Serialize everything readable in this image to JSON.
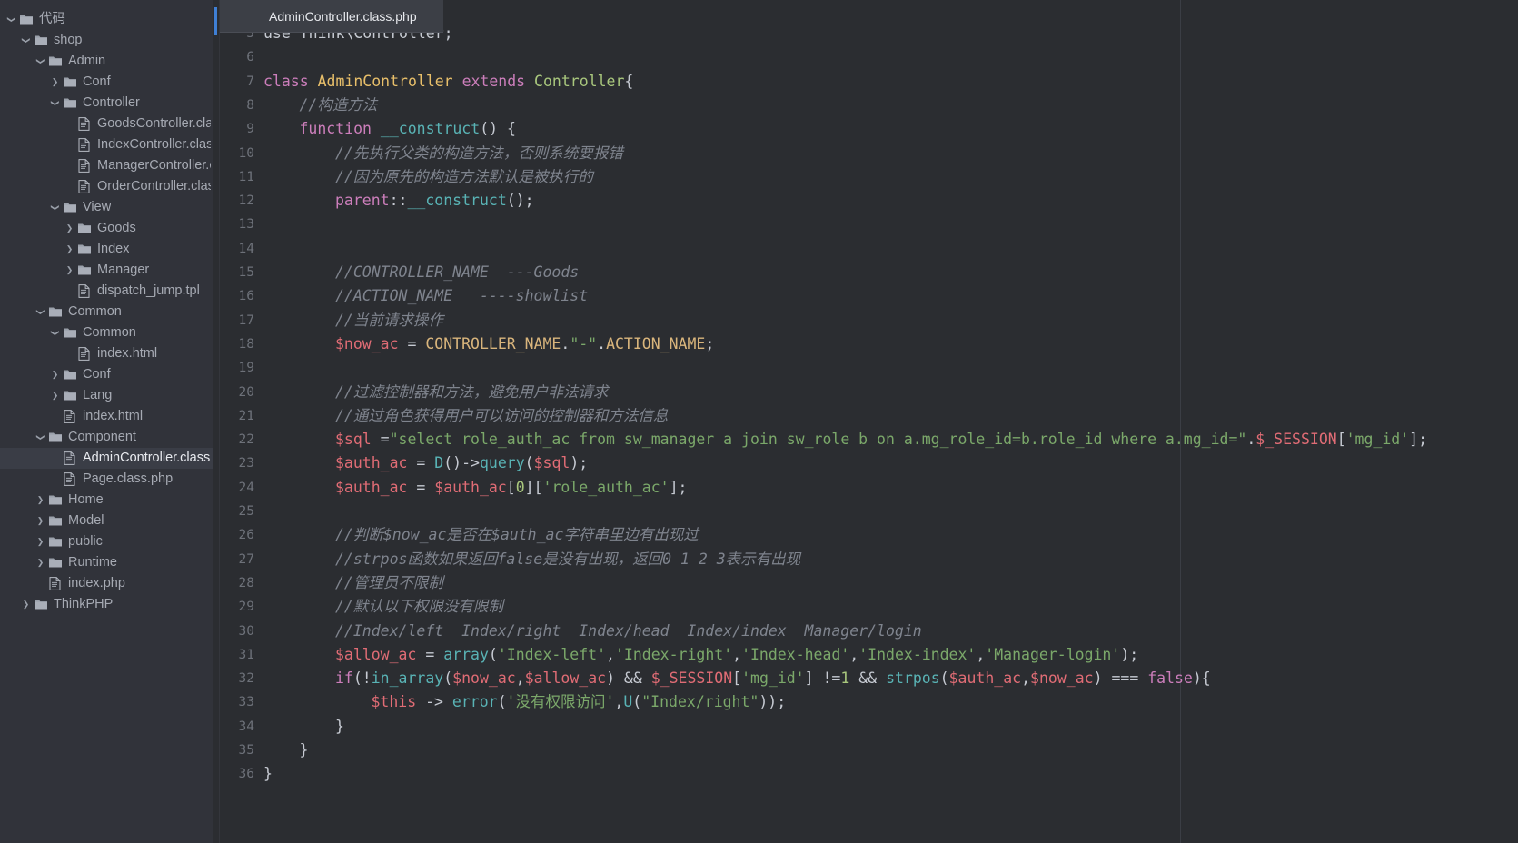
{
  "window": {
    "theme_bg": "#2b2d31",
    "sidebar_bg": "#31333a",
    "accent": "#3f7fd4"
  },
  "tab": {
    "label": "AdminController.class.php",
    "icon": "php-file-icon"
  },
  "sidebar": {
    "items": [
      {
        "label": "代码",
        "depth": 0,
        "type": "folder",
        "arrow": "expanded",
        "selected": false
      },
      {
        "label": "shop",
        "depth": 1,
        "type": "folder",
        "arrow": "expanded",
        "selected": false
      },
      {
        "label": "Admin",
        "depth": 2,
        "type": "folder",
        "arrow": "expanded",
        "selected": false
      },
      {
        "label": "Conf",
        "depth": 3,
        "type": "folder",
        "arrow": "collapsed",
        "selected": false
      },
      {
        "label": "Controller",
        "depth": 3,
        "type": "folder",
        "arrow": "expanded",
        "selected": false
      },
      {
        "label": "GoodsController.class.p",
        "depth": 4,
        "type": "file",
        "arrow": "none",
        "selected": false
      },
      {
        "label": "IndexController.class.ph",
        "depth": 4,
        "type": "file",
        "arrow": "none",
        "selected": false
      },
      {
        "label": "ManagerController.clas",
        "depth": 4,
        "type": "file",
        "arrow": "none",
        "selected": false
      },
      {
        "label": "OrderController.class.ph",
        "depth": 4,
        "type": "file",
        "arrow": "none",
        "selected": false
      },
      {
        "label": "View",
        "depth": 3,
        "type": "folder",
        "arrow": "expanded",
        "selected": false
      },
      {
        "label": "Goods",
        "depth": 4,
        "type": "folder",
        "arrow": "collapsed",
        "selected": false
      },
      {
        "label": "Index",
        "depth": 4,
        "type": "folder",
        "arrow": "collapsed",
        "selected": false
      },
      {
        "label": "Manager",
        "depth": 4,
        "type": "folder",
        "arrow": "collapsed",
        "selected": false
      },
      {
        "label": "dispatch_jump.tpl",
        "depth": 4,
        "type": "file",
        "arrow": "none",
        "selected": false
      },
      {
        "label": "Common",
        "depth": 2,
        "type": "folder",
        "arrow": "expanded",
        "selected": false
      },
      {
        "label": "Common",
        "depth": 3,
        "type": "folder",
        "arrow": "expanded",
        "selected": false
      },
      {
        "label": "index.html",
        "depth": 4,
        "type": "file",
        "arrow": "none",
        "selected": false
      },
      {
        "label": "Conf",
        "depth": 3,
        "type": "folder",
        "arrow": "collapsed",
        "selected": false
      },
      {
        "label": "Lang",
        "depth": 3,
        "type": "folder",
        "arrow": "collapsed",
        "selected": false
      },
      {
        "label": "index.html",
        "depth": 3,
        "type": "file",
        "arrow": "none",
        "selected": false
      },
      {
        "label": "Component",
        "depth": 2,
        "type": "folder",
        "arrow": "expanded",
        "selected": false
      },
      {
        "label": "AdminController.class.php",
        "depth": 3,
        "type": "file",
        "arrow": "none",
        "selected": true
      },
      {
        "label": "Page.class.php",
        "depth": 3,
        "type": "file",
        "arrow": "none",
        "selected": false
      },
      {
        "label": "Home",
        "depth": 2,
        "type": "folder",
        "arrow": "collapsed",
        "selected": false
      },
      {
        "label": "Model",
        "depth": 2,
        "type": "folder",
        "arrow": "collapsed",
        "selected": false
      },
      {
        "label": "public",
        "depth": 2,
        "type": "folder",
        "arrow": "collapsed",
        "selected": false
      },
      {
        "label": "Runtime",
        "depth": 2,
        "type": "folder",
        "arrow": "collapsed",
        "selected": false
      },
      {
        "label": "index.php",
        "depth": 2,
        "type": "file",
        "arrow": "none",
        "selected": false
      },
      {
        "label": "ThinkPHP",
        "depth": 1,
        "type": "folder",
        "arrow": "collapsed",
        "selected": false
      }
    ]
  },
  "editor": {
    "first_visible_line": 5,
    "language": "PHP",
    "lines": [
      {
        "n": 5,
        "indent": 0,
        "tokens": [
          {
            "t": "use Think\\Controller;",
            "c": "t-plain"
          }
        ],
        "clipped_top": true
      },
      {
        "n": 6,
        "indent": 0,
        "tokens": []
      },
      {
        "n": 7,
        "indent": 0,
        "tokens": [
          {
            "t": "class ",
            "c": "t-kw"
          },
          {
            "t": "AdminController ",
            "c": "t-cls"
          },
          {
            "t": "extends ",
            "c": "t-kw"
          },
          {
            "t": "Controller",
            "c": "t-type"
          },
          {
            "t": "{",
            "c": "t-plain"
          }
        ]
      },
      {
        "n": 8,
        "indent": 1,
        "tokens": [
          {
            "t": "//构造方法",
            "c": "t-cmt"
          }
        ]
      },
      {
        "n": 9,
        "indent": 1,
        "tokens": [
          {
            "t": "function ",
            "c": "t-kw"
          },
          {
            "t": "__construct",
            "c": "t-fn"
          },
          {
            "t": "() {",
            "c": "t-plain"
          }
        ]
      },
      {
        "n": 10,
        "indent": 2,
        "tokens": [
          {
            "t": "//先执行父类的构造方法，否则系统要报错",
            "c": "t-cmt"
          }
        ]
      },
      {
        "n": 11,
        "indent": 2,
        "tokens": [
          {
            "t": "//因为原先的构造方法默认是被执行的",
            "c": "t-cmt"
          }
        ]
      },
      {
        "n": 12,
        "indent": 2,
        "tokens": [
          {
            "t": "parent",
            "c": "t-sup"
          },
          {
            "t": "::",
            "c": "t-plain"
          },
          {
            "t": "__construct",
            "c": "t-fn"
          },
          {
            "t": "();",
            "c": "t-plain"
          }
        ]
      },
      {
        "n": 13,
        "indent": 0,
        "tokens": []
      },
      {
        "n": 14,
        "indent": 0,
        "tokens": []
      },
      {
        "n": 15,
        "indent": 2,
        "tokens": [
          {
            "t": "//CONTROLLER_NAME  ---Goods",
            "c": "t-cmt"
          }
        ]
      },
      {
        "n": 16,
        "indent": 2,
        "tokens": [
          {
            "t": "//ACTION_NAME   ----showlist",
            "c": "t-cmt"
          }
        ]
      },
      {
        "n": 17,
        "indent": 2,
        "tokens": [
          {
            "t": "//当前请求操作",
            "c": "t-cmt"
          }
        ]
      },
      {
        "n": 18,
        "indent": 2,
        "tokens": [
          {
            "t": "$now_ac",
            "c": "t-var"
          },
          {
            "t": " = ",
            "c": "t-plain"
          },
          {
            "t": "CONTROLLER_NAME",
            "c": "t-const"
          },
          {
            "t": ".",
            "c": "t-plain"
          },
          {
            "t": "\"-\"",
            "c": "t-str"
          },
          {
            "t": ".",
            "c": "t-plain"
          },
          {
            "t": "ACTION_NAME",
            "c": "t-const"
          },
          {
            "t": ";",
            "c": "t-plain"
          }
        ]
      },
      {
        "n": 19,
        "indent": 0,
        "tokens": []
      },
      {
        "n": 20,
        "indent": 2,
        "tokens": [
          {
            "t": "//过滤控制器和方法，避免用户非法请求",
            "c": "t-cmt"
          }
        ]
      },
      {
        "n": 21,
        "indent": 2,
        "tokens": [
          {
            "t": "//通过角色获得用户可以访问的控制器和方法信息",
            "c": "t-cmt"
          }
        ]
      },
      {
        "n": 22,
        "indent": 2,
        "tokens": [
          {
            "t": "$sql",
            "c": "t-var"
          },
          {
            "t": " =",
            "c": "t-plain"
          },
          {
            "t": "\"select role_auth_ac from sw_manager a join sw_role b on a.mg_role_id=b.role_id where a.mg_id=\"",
            "c": "t-str"
          },
          {
            "t": ".",
            "c": "t-plain"
          },
          {
            "t": "$_SESSION",
            "c": "t-var"
          },
          {
            "t": "[",
            "c": "t-plain"
          },
          {
            "t": "'mg_id'",
            "c": "t-str"
          },
          {
            "t": "];",
            "c": "t-plain"
          }
        ]
      },
      {
        "n": 23,
        "indent": 2,
        "tokens": [
          {
            "t": "$auth_ac",
            "c": "t-var"
          },
          {
            "t": " = ",
            "c": "t-plain"
          },
          {
            "t": "D",
            "c": "t-fn"
          },
          {
            "t": "()->",
            "c": "t-plain"
          },
          {
            "t": "query",
            "c": "t-fn"
          },
          {
            "t": "(",
            "c": "t-plain"
          },
          {
            "t": "$sql",
            "c": "t-var"
          },
          {
            "t": ");",
            "c": "t-plain"
          }
        ]
      },
      {
        "n": 24,
        "indent": 2,
        "tokens": [
          {
            "t": "$auth_ac",
            "c": "t-var"
          },
          {
            "t": " = ",
            "c": "t-plain"
          },
          {
            "t": "$auth_ac",
            "c": "t-var"
          },
          {
            "t": "[",
            "c": "t-plain"
          },
          {
            "t": "0",
            "c": "t-num"
          },
          {
            "t": "][",
            "c": "t-plain"
          },
          {
            "t": "'role_auth_ac'",
            "c": "t-str"
          },
          {
            "t": "];",
            "c": "t-plain"
          }
        ]
      },
      {
        "n": 25,
        "indent": 0,
        "tokens": []
      },
      {
        "n": 26,
        "indent": 2,
        "tokens": [
          {
            "t": "//判断$now_ac是否在$auth_ac字符串里边有出现过",
            "c": "t-cmt"
          }
        ]
      },
      {
        "n": 27,
        "indent": 2,
        "tokens": [
          {
            "t": "//strpos函数如果返回false是没有出现，返回0 1 2 3表示有出现",
            "c": "t-cmt"
          }
        ]
      },
      {
        "n": 28,
        "indent": 2,
        "tokens": [
          {
            "t": "//管理员不限制",
            "c": "t-cmt"
          }
        ]
      },
      {
        "n": 29,
        "indent": 2,
        "tokens": [
          {
            "t": "//默认以下权限没有限制",
            "c": "t-cmt"
          }
        ]
      },
      {
        "n": 30,
        "indent": 2,
        "tokens": [
          {
            "t": "//Index/left  Index/right  Index/head  Index/index  Manager/login",
            "c": "t-cmt"
          }
        ]
      },
      {
        "n": 31,
        "indent": 2,
        "tokens": [
          {
            "t": "$allow_ac",
            "c": "t-var"
          },
          {
            "t": " = ",
            "c": "t-plain"
          },
          {
            "t": "array",
            "c": "t-fn"
          },
          {
            "t": "(",
            "c": "t-plain"
          },
          {
            "t": "'Index-left'",
            "c": "t-str"
          },
          {
            "t": ",",
            "c": "t-plain"
          },
          {
            "t": "'Index-right'",
            "c": "t-str"
          },
          {
            "t": ",",
            "c": "t-plain"
          },
          {
            "t": "'Index-head'",
            "c": "t-str"
          },
          {
            "t": ",",
            "c": "t-plain"
          },
          {
            "t": "'Index-index'",
            "c": "t-str"
          },
          {
            "t": ",",
            "c": "t-plain"
          },
          {
            "t": "'Manager-login'",
            "c": "t-str"
          },
          {
            "t": ");",
            "c": "t-plain"
          }
        ]
      },
      {
        "n": 32,
        "indent": 2,
        "tokens": [
          {
            "t": "if",
            "c": "t-kw"
          },
          {
            "t": "(!",
            "c": "t-plain"
          },
          {
            "t": "in_array",
            "c": "t-fn"
          },
          {
            "t": "(",
            "c": "t-plain"
          },
          {
            "t": "$now_ac",
            "c": "t-var"
          },
          {
            "t": ",",
            "c": "t-plain"
          },
          {
            "t": "$allow_ac",
            "c": "t-var"
          },
          {
            "t": ") && ",
            "c": "t-plain"
          },
          {
            "t": "$_SESSION",
            "c": "t-var"
          },
          {
            "t": "[",
            "c": "t-plain"
          },
          {
            "t": "'mg_id'",
            "c": "t-str"
          },
          {
            "t": "] !=",
            "c": "t-plain"
          },
          {
            "t": "1",
            "c": "t-num"
          },
          {
            "t": " && ",
            "c": "t-plain"
          },
          {
            "t": "strpos",
            "c": "t-fn"
          },
          {
            "t": "(",
            "c": "t-plain"
          },
          {
            "t": "$auth_ac",
            "c": "t-var"
          },
          {
            "t": ",",
            "c": "t-plain"
          },
          {
            "t": "$now_ac",
            "c": "t-var"
          },
          {
            "t": ") === ",
            "c": "t-plain"
          },
          {
            "t": "false",
            "c": "t-kw"
          },
          {
            "t": "){",
            "c": "t-plain"
          }
        ]
      },
      {
        "n": 33,
        "indent": 3,
        "tokens": [
          {
            "t": "$this",
            "c": "t-var"
          },
          {
            "t": " -> ",
            "c": "t-plain"
          },
          {
            "t": "error",
            "c": "t-fn"
          },
          {
            "t": "(",
            "c": "t-plain"
          },
          {
            "t": "'没有权限访问'",
            "c": "t-str"
          },
          {
            "t": ",",
            "c": "t-plain"
          },
          {
            "t": "U",
            "c": "t-fn"
          },
          {
            "t": "(",
            "c": "t-plain"
          },
          {
            "t": "\"Index/right\"",
            "c": "t-str"
          },
          {
            "t": "));",
            "c": "t-plain"
          }
        ]
      },
      {
        "n": 34,
        "indent": 2,
        "tokens": [
          {
            "t": "}",
            "c": "t-plain"
          }
        ]
      },
      {
        "n": 35,
        "indent": 1,
        "tokens": [
          {
            "t": "}",
            "c": "t-plain"
          }
        ]
      },
      {
        "n": 36,
        "indent": 0,
        "tokens": [
          {
            "t": "}",
            "c": "t-plain"
          }
        ]
      }
    ]
  }
}
